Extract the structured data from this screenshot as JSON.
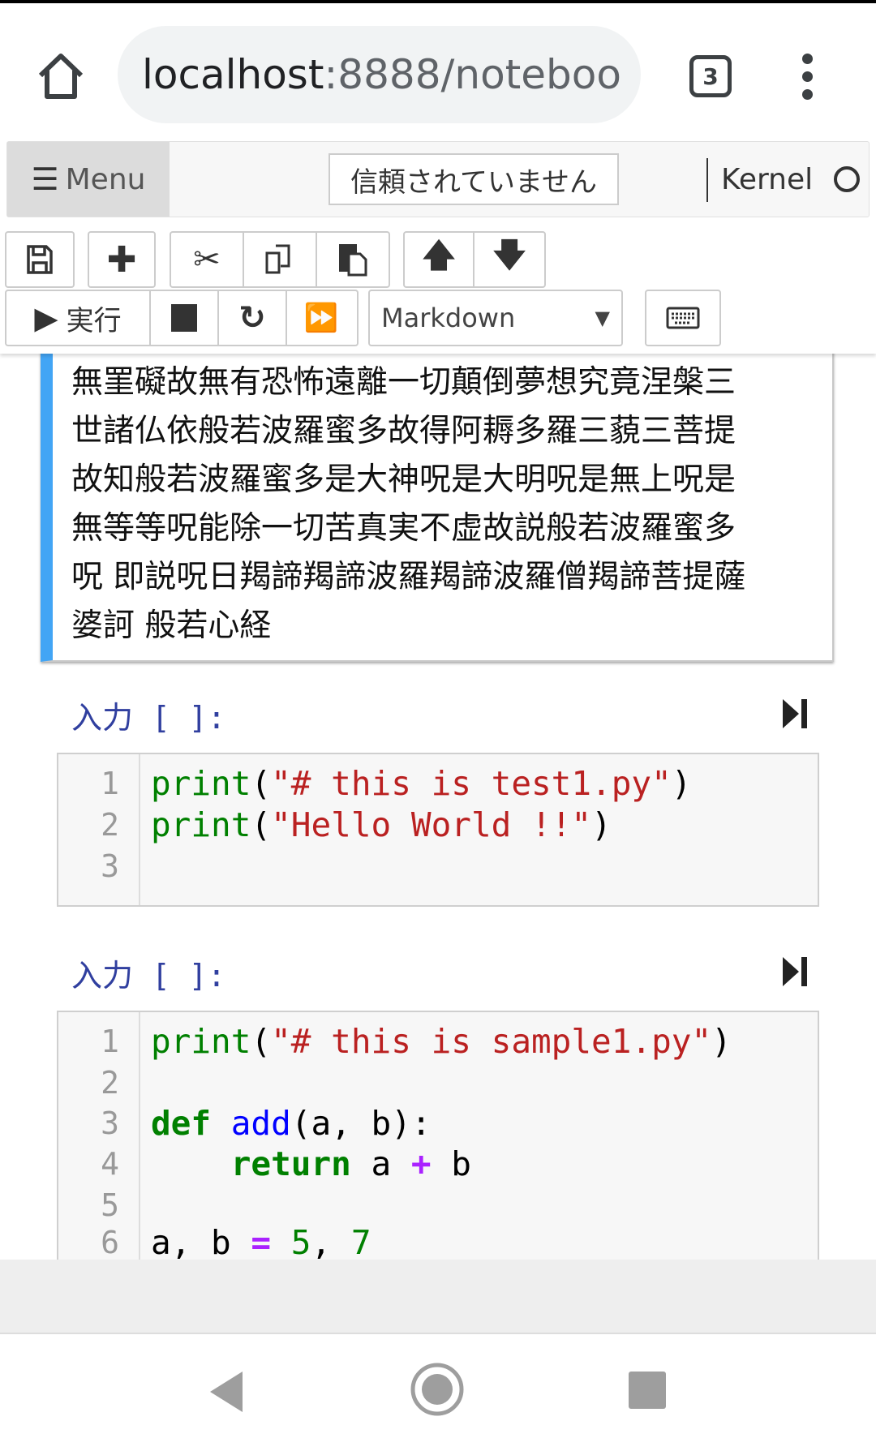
{
  "browser": {
    "url_host": "localhost",
    "url_rest": ":8888/noteboo",
    "tab_count": "3"
  },
  "header": {
    "menu_label": "Menu",
    "trust_label": "信頼されていません",
    "kernel_label": "Kernel"
  },
  "toolbar": {
    "run_label": "実行",
    "cell_type": "Markdown"
  },
  "markdown_cell": {
    "lines": [
      "無罣礙故無有恐怖遠離一切顛倒夢想究竟涅槃三",
      "世諸仏依般若波羅蜜多故得阿耨多羅三藐三菩提",
      "故知般若波羅蜜多是大神呪是大明呪是無上呪是",
      "無等等呪能除一切苦真実不虚故説般若波羅蜜多",
      "呪 即説呪日羯諦羯諦波羅羯諦波羅僧羯諦菩提薩",
      "婆訶 般若心経"
    ]
  },
  "cells": [
    {
      "prompt": "入力 [ ]:",
      "lines": [
        "print(\"# this is test1.py\")",
        "print(\"Hello World !!\")",
        ""
      ]
    },
    {
      "prompt": "入力 [ ]:",
      "lines": [
        "print(\"# this is sample1.py\")",
        "",
        "def add(a, b):",
        "    return a + b",
        "",
        "a, b = 5, 7"
      ]
    }
  ],
  "colors": {
    "accent": "#42a5f5",
    "prompt": "#303f9f",
    "keyword": "#008000",
    "string": "#ba2121",
    "function": "#0000ff",
    "operator": "#aa22ff"
  }
}
